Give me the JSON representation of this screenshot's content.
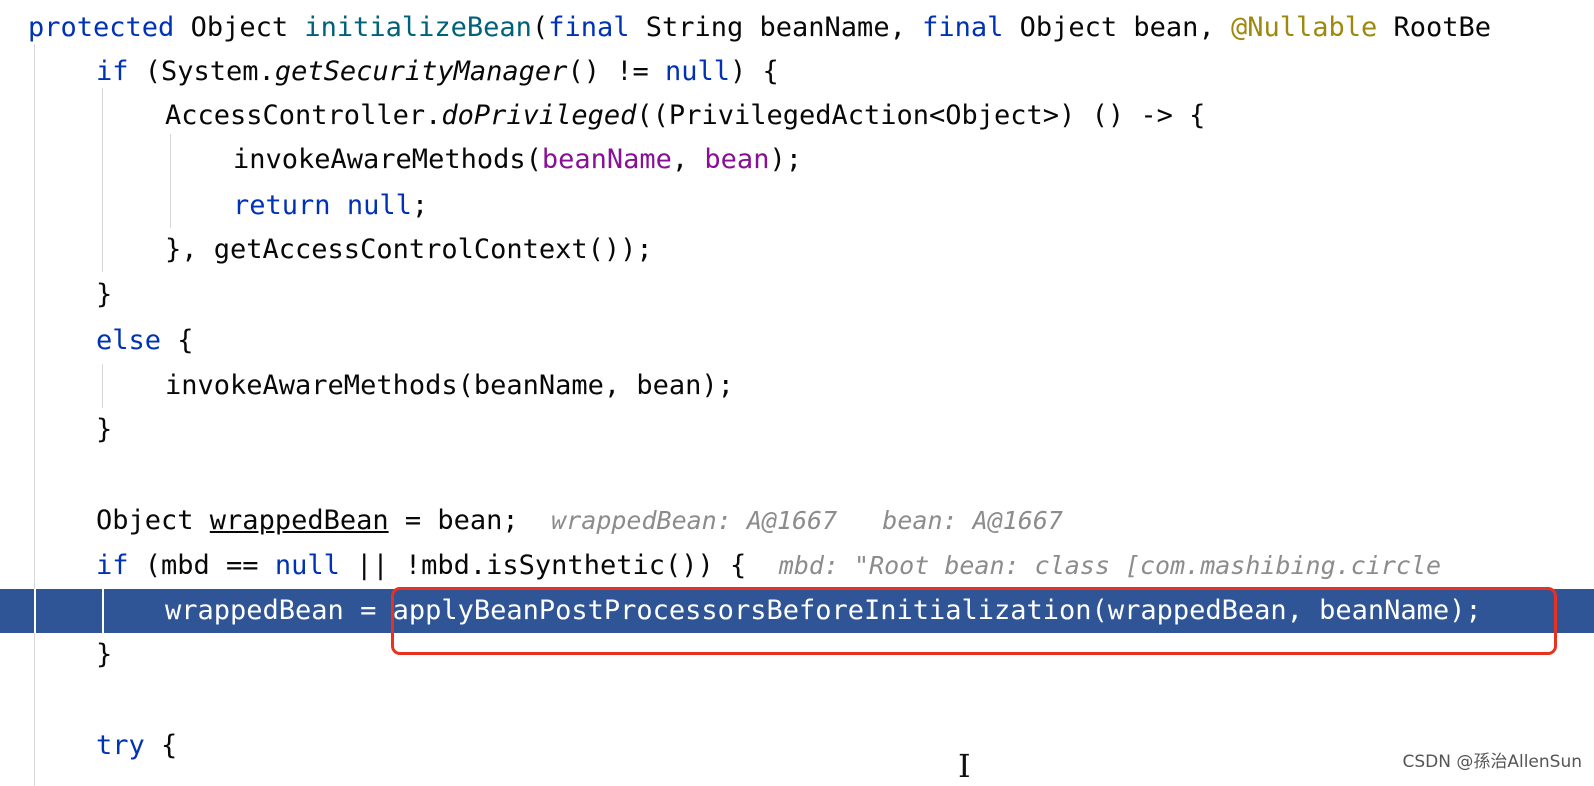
{
  "code": {
    "l1": {
      "kw1": "protected",
      "t1": " Object ",
      "fn": "initializeBean",
      "t2": "(",
      "kw2": "final",
      "t3": " String beanName, ",
      "kw3": "final",
      "t4": " Object bean, ",
      "ann": "@Nullable",
      "t5": " RootBe"
    },
    "l2": {
      "kw1": "if",
      "t1": " (System.",
      "it": "getSecurityManager",
      "t2": "() != ",
      "kw2": "null",
      "t3": ") {"
    },
    "l3": {
      "t1": "AccessController.",
      "it": "doPrivileged",
      "t2": "((PrivilegedAction<Object>) () -> {"
    },
    "l4": {
      "t1": "invokeAwareMethods(",
      "p1": "beanName",
      "t2": ", ",
      "p2": "bean",
      "t3": ");"
    },
    "l5": {
      "kw1": "return",
      "t1": " ",
      "kw2": "null",
      "t2": ";"
    },
    "l6": {
      "t1": "}, getAccessControlContext());"
    },
    "l7": {
      "t1": "}"
    },
    "l8": {
      "kw1": "else",
      "t1": " {"
    },
    "l9": {
      "t1": "invokeAwareMethods(beanName, bean);"
    },
    "l10": {
      "t1": "}"
    },
    "l12": {
      "t1": "Object ",
      "ul": "wrappedBean",
      "t2": " = bean;",
      "hint": "wrappedBean: A@1667   bean: A@1667"
    },
    "l13": {
      "kw1": "if",
      "t1": " (mbd == ",
      "kw2": "null",
      "t2": " || !mbd.isSynthetic()) {",
      "hint": "mbd: \"Root bean: class [com.mashibing.circle"
    },
    "l14": {
      "t1": "wrappedBean = ",
      "t2": "applyBeanPostProcessorsBeforeInitialization(wrappedBean, beanName);"
    },
    "l15": {
      "t1": "}"
    },
    "l17": {
      "kw1": "try",
      "t1": " {"
    }
  },
  "cursor_glyph": "I",
  "watermark": "CSDN @孫治AllenSun"
}
